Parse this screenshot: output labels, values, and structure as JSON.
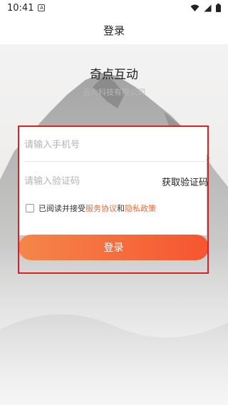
{
  "status_bar": {
    "time": "10:41",
    "indicator": "A",
    "icons": [
      "wifi-icon",
      "signal-icon",
      "battery-icon"
    ]
  },
  "nav": {
    "title": "登录"
  },
  "brand": {
    "name": "奇点互动",
    "company": "云火科技有限公司"
  },
  "form": {
    "phone_placeholder": "请输入手机号",
    "code_placeholder": "请输入验证码",
    "get_code": "获取验证码",
    "agree_prefix": "已阅读并接受",
    "service_link": "服务协议",
    "and": "和",
    "privacy_link": "隐私政策",
    "checked": false,
    "submit_label": "登录"
  },
  "colors": {
    "accent": "#f26a35",
    "button_start": "#f5864a",
    "button_end": "#f65530",
    "highlight": "#e02020"
  }
}
